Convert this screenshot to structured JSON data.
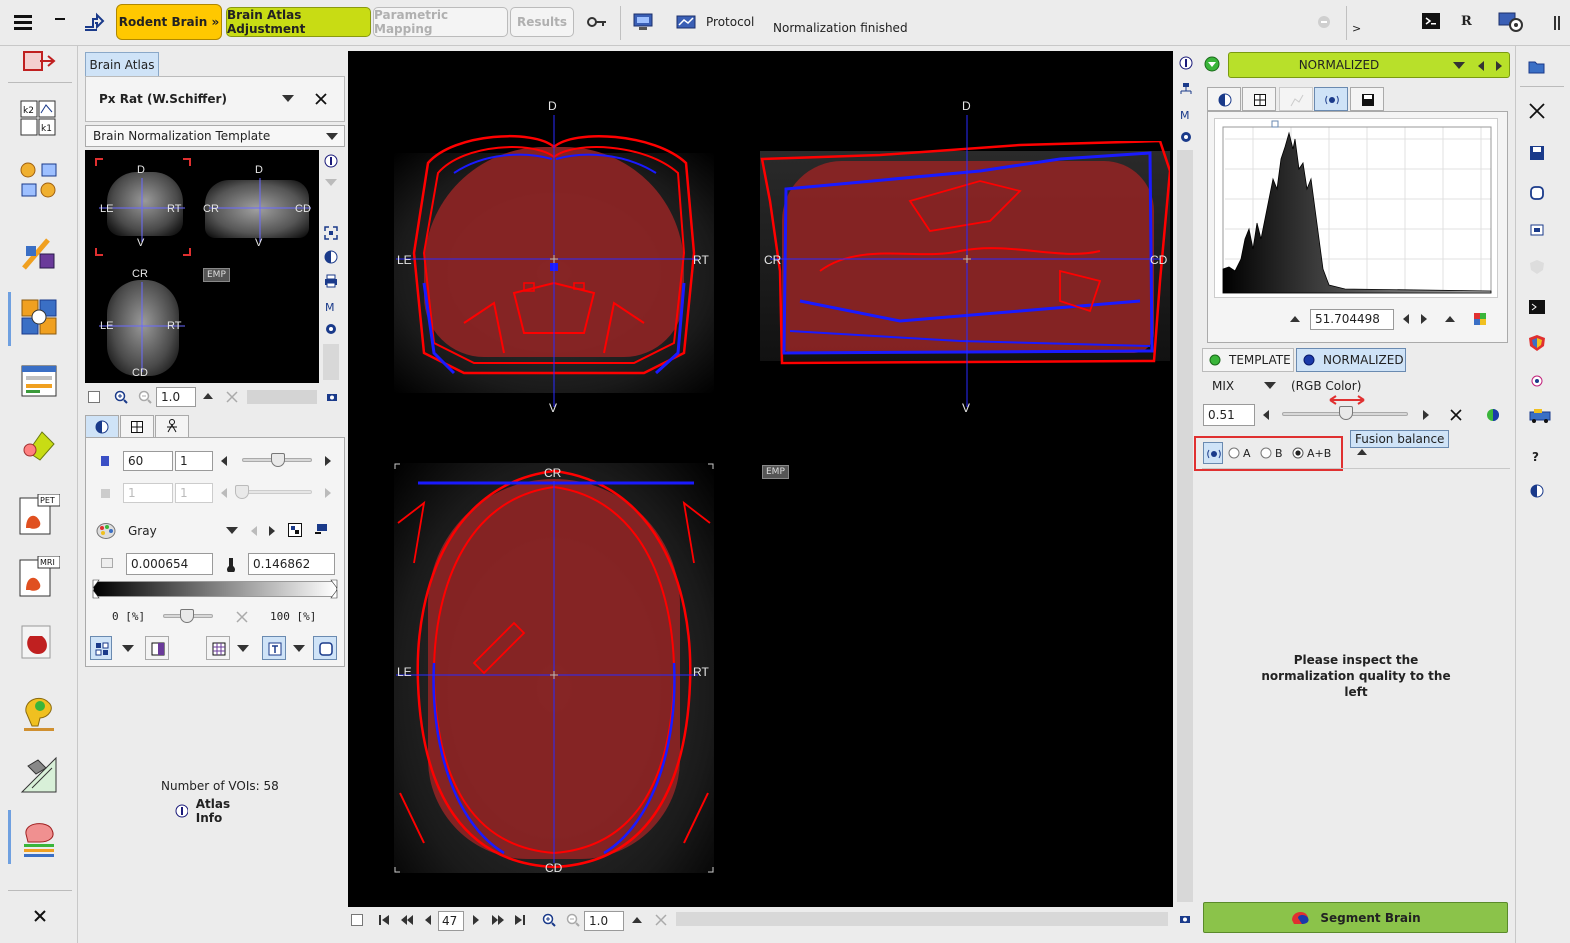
{
  "toolbar": {
    "rodent_brain": "Rodent Brain »",
    "brain_atlas_adjustment": "Brain Atlas Adjustment",
    "parametric_mapping": "Parametric Mapping",
    "results": "Results",
    "protocol": "Protocol",
    "status": "Normalization finished",
    "right_r": "R",
    "right_gt": ">"
  },
  "left_panel": {
    "tab": "Brain Atlas",
    "atlas_name": "Px Rat (W.Schiffer)",
    "template_select": "Brain Normalization Template",
    "thumb_labels": {
      "d": "D",
      "v": "V",
      "le": "LE",
      "rt": "RT",
      "cr": "CR",
      "cd": "CD"
    },
    "emp": "EMP",
    "zoom_value": "1.0",
    "frame_value": "60",
    "frame_step": "1",
    "frame2_value": "1",
    "frame2_step": "1",
    "colormap": "Gray",
    "min_value": "0.000654",
    "max_value": "0.146862",
    "range_min_label": "0  [%]",
    "range_max_label": "100  [%]",
    "voi_count": "Number of VOIs: 58",
    "atlas_info": "Atlas Info"
  },
  "viewer": {
    "labels": {
      "d": "D",
      "v": "V",
      "le": "LE",
      "rt": "RT",
      "cr": "CR",
      "cd": "CD"
    },
    "emp": "EMP",
    "slice_value": "47",
    "zoom_value": "1.0"
  },
  "right_panel": {
    "series_name": "NORMALIZED",
    "histogram_value": "51.704498",
    "template_tab": "TEMPLATE",
    "normalized_tab": "NORMALIZED",
    "mix_label": "MIX",
    "rgb_label": "(RGB Color)",
    "balance_value": "0.51",
    "balance_fraction": 0.51,
    "tooltip": "Fusion balance",
    "radio_a": "A",
    "radio_b": "B",
    "radio_ab": "A+B",
    "inspect_text": "Please inspect the normalization quality to the left",
    "segment_button": "Segment Brain"
  },
  "colors": {
    "rodent_btn": "#ffc800",
    "atlas_btn": "#c8dc14",
    "segment_btn": "#8bc34a",
    "series_bar": "#b8e02a",
    "highlight_box": "#e03030",
    "overlay_red": "#ff0000",
    "overlay_blue": "#1a1aff"
  }
}
